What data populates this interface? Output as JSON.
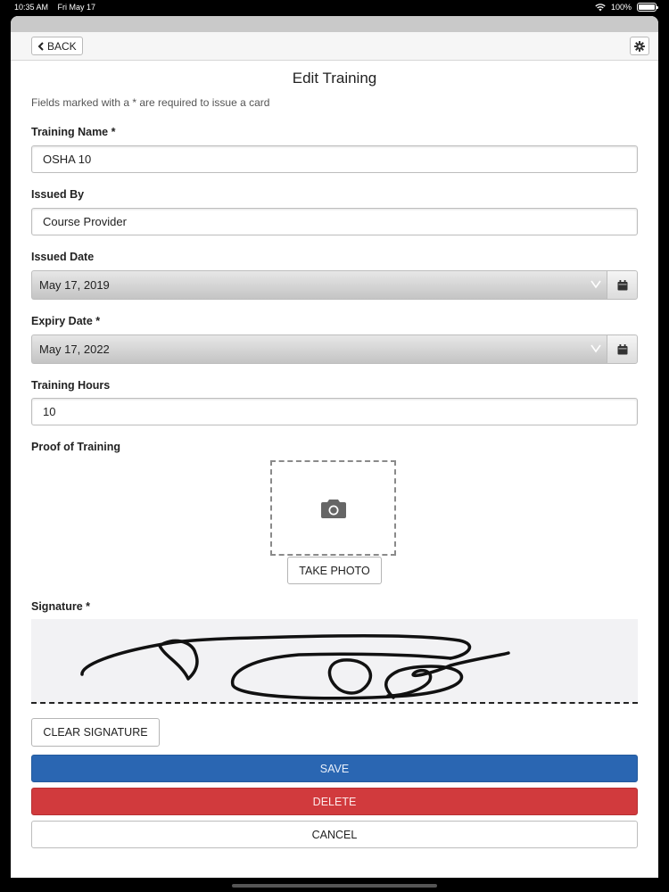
{
  "status_bar": {
    "time": "10:35 AM",
    "date": "Fri May 17",
    "battery": "100%"
  },
  "nav": {
    "back_label": "BACK"
  },
  "page": {
    "title": "Edit Training",
    "hint": "Fields marked with a * are required to issue a card"
  },
  "fields": {
    "training_name": {
      "label": "Training Name *",
      "value": "OSHA 10"
    },
    "issued_by": {
      "label": "Issued By",
      "value": "Course Provider"
    },
    "issued_date": {
      "label": "Issued Date",
      "value": "May 17, 2019"
    },
    "expiry_date": {
      "label": "Expiry Date *",
      "value": "May 17, 2022"
    },
    "training_hours": {
      "label": "Training Hours",
      "value": "10"
    }
  },
  "proof": {
    "label": "Proof of Training",
    "take_photo_label": "TAKE PHOTO"
  },
  "signature": {
    "label": "Signature *",
    "clear_label": "CLEAR SIGNATURE"
  },
  "actions": {
    "save": "SAVE",
    "delete": "DELETE",
    "cancel": "CANCEL"
  },
  "icons": {
    "back": "chevron-left-icon",
    "settings": "gear-icon",
    "calendar": "calendar-icon",
    "camera": "camera-icon",
    "wifi": "wifi-icon",
    "battery": "battery-icon"
  },
  "colors": {
    "save": "#2a66b2",
    "delete": "#d13a3d"
  }
}
